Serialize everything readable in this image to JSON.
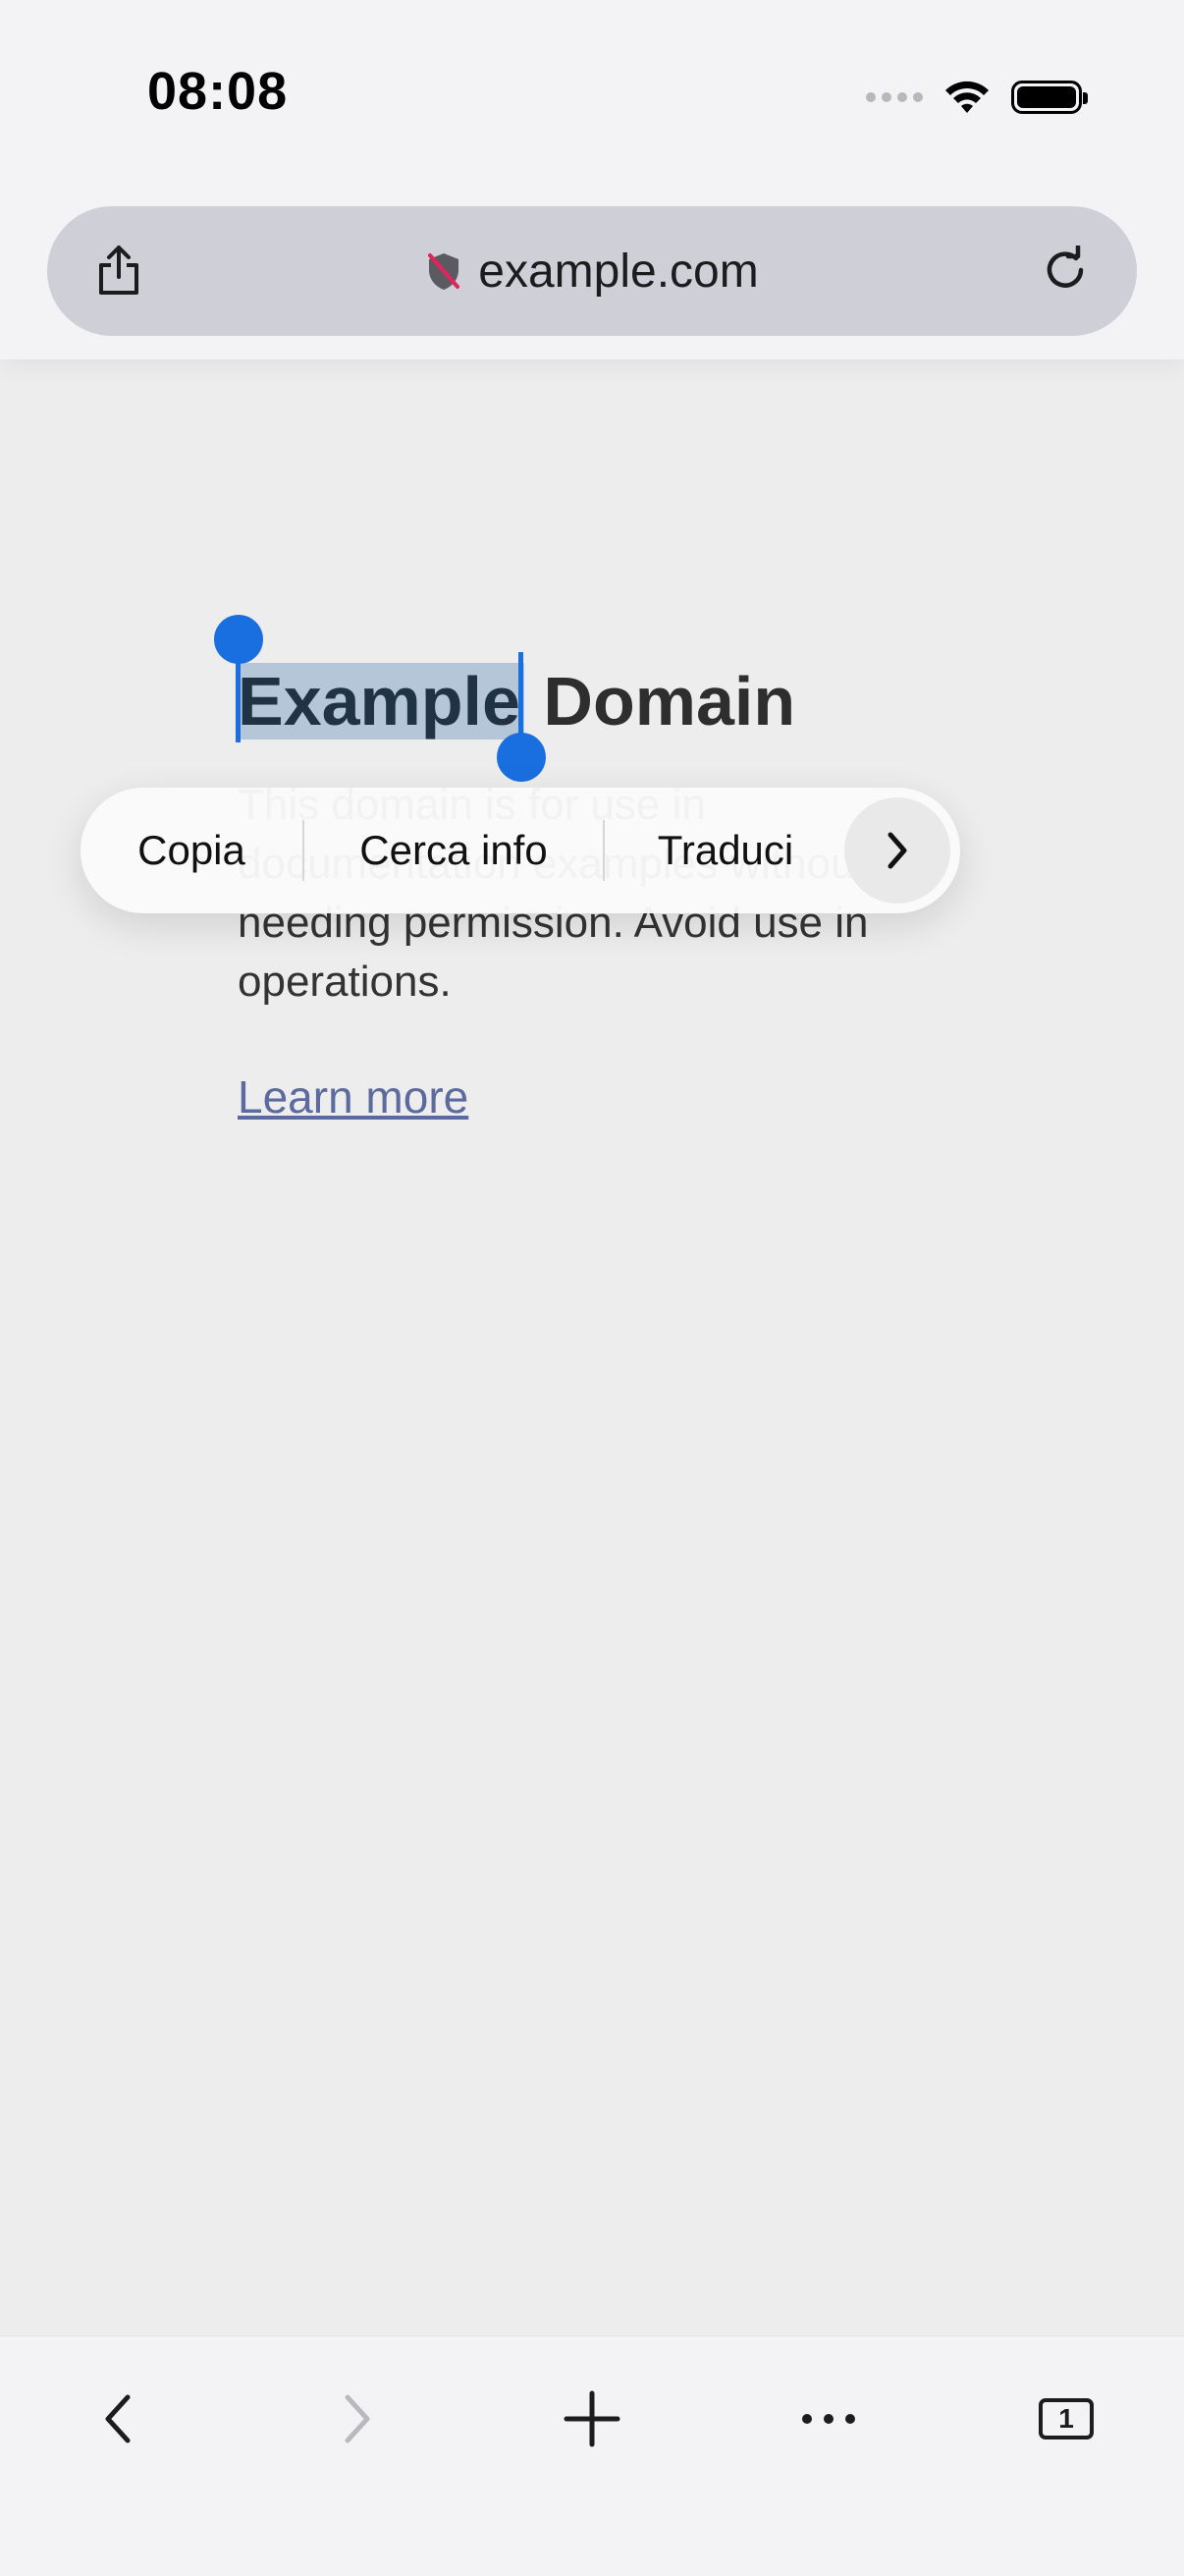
{
  "status_bar": {
    "time": "08:08"
  },
  "address_bar": {
    "url": "example.com"
  },
  "page": {
    "title_selected": "Example",
    "title_rest": " Domain",
    "paragraph": "This domain is for use in documentation examples without needing permission. Avoid use in operations.",
    "link": "Learn more"
  },
  "context_menu": {
    "items": [
      "Copia",
      "Cerca info",
      "Traduci"
    ]
  },
  "toolbar": {
    "tab_count": "1"
  },
  "colors": {
    "accent": "#1a6fe0",
    "selection": "#b5c6d9",
    "link": "#5c6a9e"
  }
}
